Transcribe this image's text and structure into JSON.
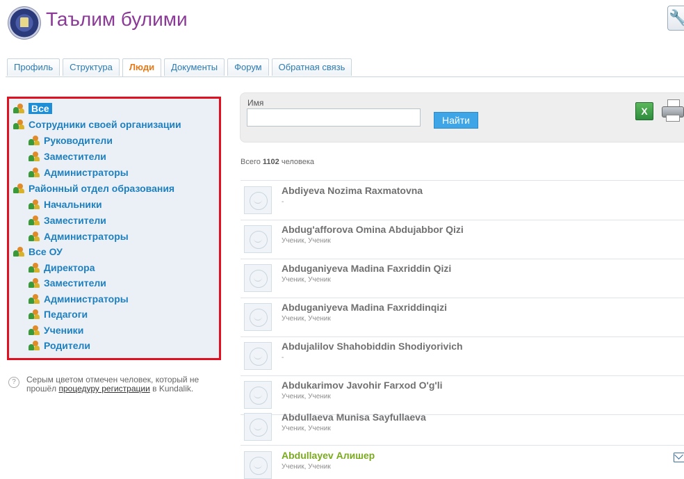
{
  "header": {
    "title": "Таълим булими",
    "logo_icon": "school-emblem-icon",
    "tool_icon": "wrench-icon"
  },
  "tabs": [
    {
      "label": "Профиль",
      "active": false
    },
    {
      "label": "Структура",
      "active": false
    },
    {
      "label": "Люди",
      "active": true
    },
    {
      "label": "Документы",
      "active": false
    },
    {
      "label": "Форум",
      "active": false
    },
    {
      "label": "Обратная связь",
      "active": false
    }
  ],
  "tree": {
    "items": [
      {
        "label": "Все",
        "selected": true
      },
      {
        "label": "Сотрудники своей организации"
      },
      {
        "label": "Руководители"
      },
      {
        "label": "Заместители"
      },
      {
        "label": "Администраторы"
      },
      {
        "label": "Районный отдел образования"
      },
      {
        "label": "Начальники"
      },
      {
        "label": "Заместители"
      },
      {
        "label": "Администраторы"
      },
      {
        "label": "Все ОУ"
      },
      {
        "label": "Директора"
      },
      {
        "label": "Заместители"
      },
      {
        "label": "Администраторы"
      },
      {
        "label": "Педагоги"
      },
      {
        "label": "Ученики"
      },
      {
        "label": "Родители"
      }
    ]
  },
  "help": {
    "text_before": "Серым цветом отмечен человек, который не прошёл ",
    "link": "процедуру регистрации",
    "text_after": " в Kundalik."
  },
  "search": {
    "label": "Имя",
    "value": "",
    "button": "Найти"
  },
  "total": {
    "prefix": "Всего ",
    "count": "1102",
    "suffix": " человека"
  },
  "people": [
    {
      "name": "Abdiyeva Nozima Raxmatovna",
      "role": "-",
      "registered": false
    },
    {
      "name": "Abdug'afforova Omina Abdujabbor Qizi",
      "role": "Ученик, Ученик",
      "registered": false
    },
    {
      "name": "Abduganiyeva Madina Faxriddin Qizi",
      "role": "Ученик, Ученик",
      "registered": false
    },
    {
      "name": "Abduganiyeva Madina Faxriddinqizi",
      "role": "Ученик, Ученик",
      "registered": false
    },
    {
      "name": "Abdujalilov Shahobiddin Shodiyorivich",
      "role": "-",
      "registered": false
    },
    {
      "name": "Abdukarimov Javohir Farxod O'g'li",
      "role": "Ученик, Ученик",
      "registered": false
    },
    {
      "name": "Abdullaeva Munisa Sayfullaeva",
      "role": "Ученик, Ученик",
      "registered": false
    },
    {
      "name": "Abdullayev Алишер",
      "role": "Ученик, Ученик",
      "registered": true
    }
  ],
  "colors": {
    "brand_title": "#8a3a96",
    "link_blue": "#1e7fbf",
    "active_tab": "#e67817",
    "registered_name": "#7aaa1e",
    "unregistered_name": "#707070",
    "highlight_border": "#e01020"
  }
}
